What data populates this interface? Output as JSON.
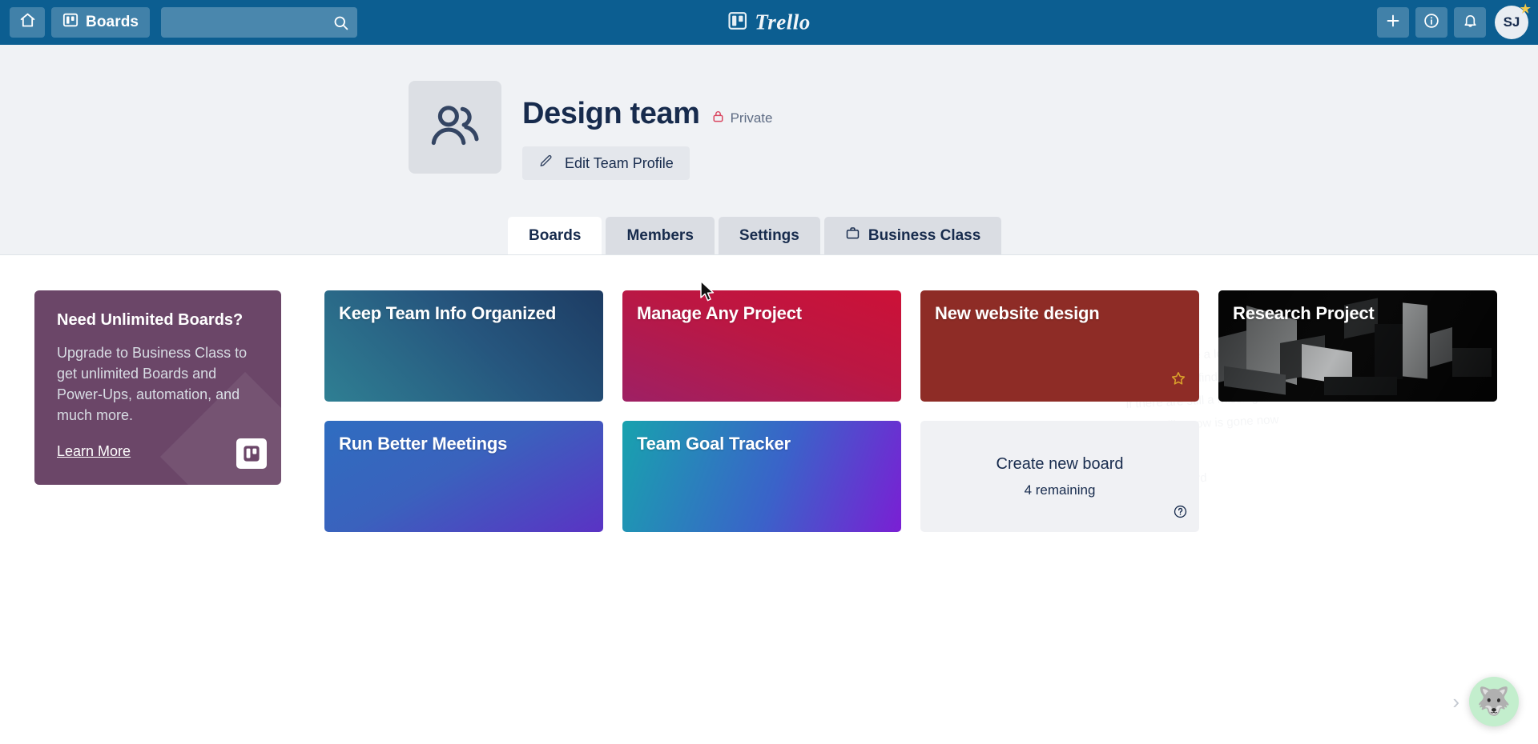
{
  "top_nav": {
    "home_label": "Home",
    "boards_label": "Boards",
    "search_placeholder": "",
    "search_value": "",
    "logo_text": "Trello",
    "add_label": "+",
    "info_label": "i",
    "notifications_label": "Notifications",
    "avatar_initials": "SJ"
  },
  "team": {
    "name": "Design team",
    "visibility": "Private",
    "edit_profile_label": "Edit Team Profile"
  },
  "tabs": [
    {
      "label": "Boards",
      "active": true
    },
    {
      "label": "Members",
      "active": false
    },
    {
      "label": "Settings",
      "active": false
    },
    {
      "label": "Business Class",
      "active": false
    }
  ],
  "upgrade_card": {
    "title": "Need Unlimited Boards?",
    "body": "Upgrade to Business Class to get unlimited Boards and Power-Ups, automation, and much more.",
    "link_label": "Learn More",
    "background_color": "#6b4668"
  },
  "boards": [
    {
      "title": "Keep Team Info Organized",
      "background": "linear-gradient(225deg, #1d3c63 0%, #26567e 45%, #2f7f93 100%)",
      "starred": false
    },
    {
      "title": "Manage Any Project",
      "background": "linear-gradient(200deg, #cc1137 0%, #bb1743 45%, #9e2064 100%)",
      "starred": false
    },
    {
      "title": "New website design",
      "background": "#8e2c26",
      "starred": true
    },
    {
      "title": "Research Project",
      "background": "photo",
      "starred": false
    },
    {
      "title": "Run Better Meetings",
      "background": "linear-gradient(150deg, #2f6dc0 0%, #3a62bd 45%, #5a33c4 100%)",
      "starred": false
    },
    {
      "title": "Team Goal Tracker",
      "background": "linear-gradient(110deg, #18a2ae 0%, #3a63c9 55%, #7a1fd4 100%)",
      "starred": false
    }
  ],
  "create_board": {
    "label": "Create new board",
    "remaining": "4 remaining",
    "help_label": "?"
  },
  "chat_widget": {
    "chevron": "›",
    "avatar_emoji": "🐺"
  },
  "ghost_overlay": {
    "line1": "That looks like a long",
    "line2": "impossible to find a way to",
    "line3": "if there are still a missing",
    "line4": "it looks like now is gone now",
    "line5": "type the board"
  },
  "colors": {
    "nav_background": "#0c5e91",
    "team_header_background": "#f0f2f5",
    "content_background": "#ffffff",
    "text_primary": "#172b4d",
    "text_muted": "#5e6c84",
    "lock_red": "#d9455f",
    "star_gold": "#d9a02b"
  }
}
